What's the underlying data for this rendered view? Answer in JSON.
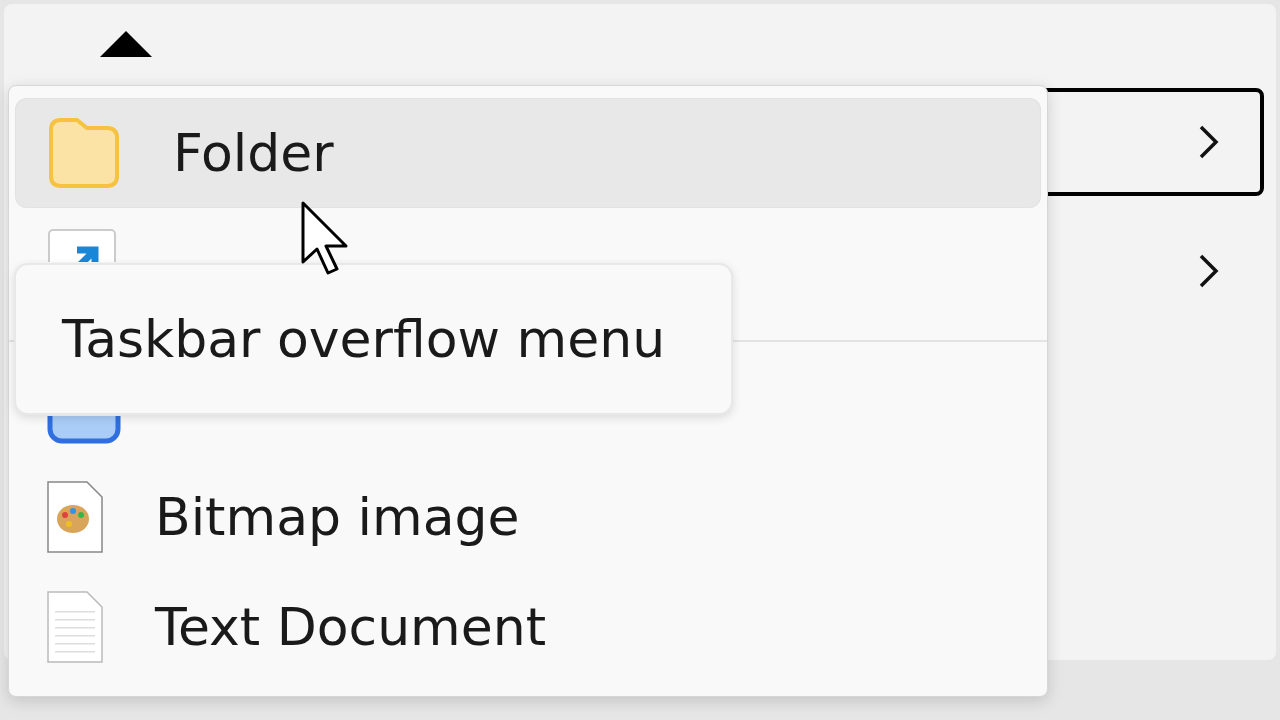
{
  "parent_menu": {
    "items": [
      {
        "focused": true
      },
      {
        "focused": false
      }
    ]
  },
  "menu": {
    "items": [
      {
        "kind": "folder",
        "label": "Folder",
        "hovered": true
      },
      {
        "kind": "shortcut",
        "hovered": false
      },
      {
        "kind": "separator"
      },
      {
        "kind": "batch",
        "hovered": false
      },
      {
        "kind": "bitmap",
        "label": "Bitmap image",
        "hovered": false
      },
      {
        "kind": "text",
        "label": "Text Document",
        "hovered": false
      }
    ]
  },
  "tooltip": {
    "text": "Taskbar overflow menu"
  }
}
